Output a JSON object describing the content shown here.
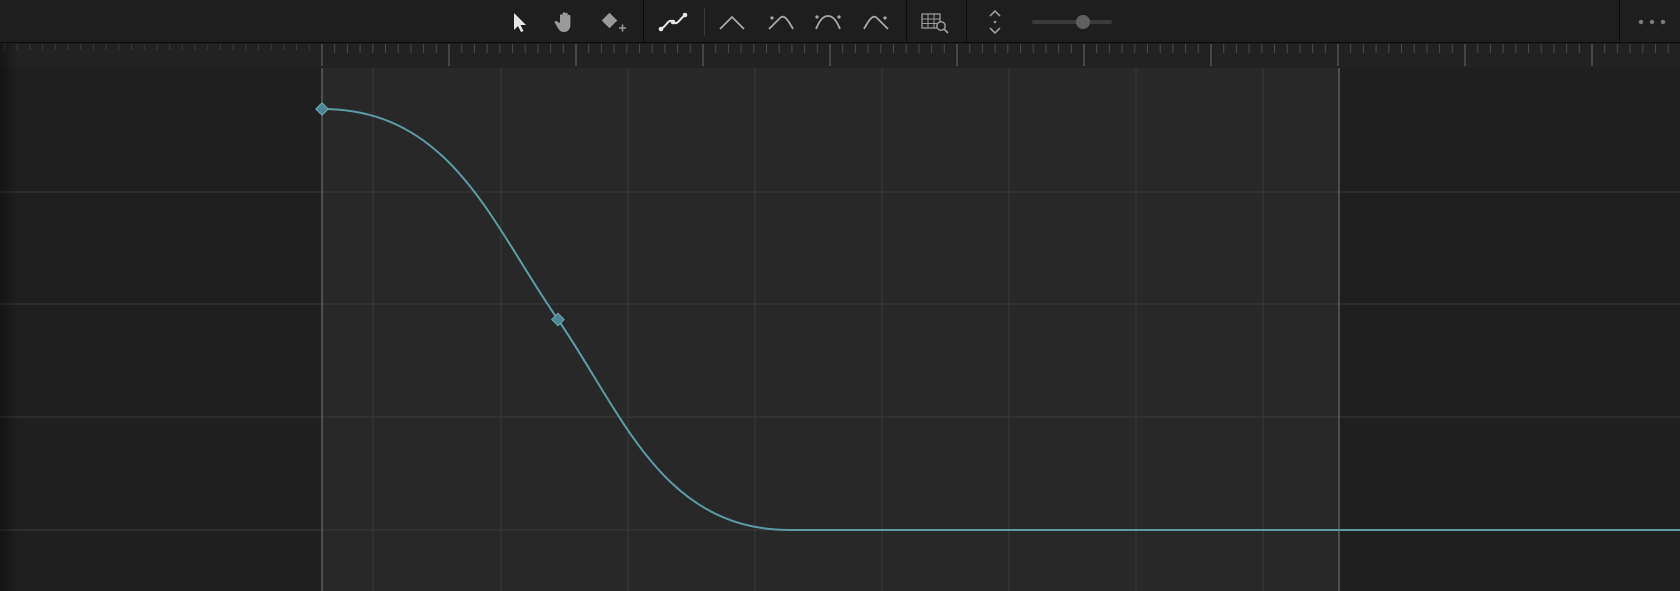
{
  "toolbar": {
    "tools": [
      {
        "name": "select-tool",
        "icon": "arrow-cursor-icon",
        "active": true
      },
      {
        "name": "pan-tool",
        "icon": "hand-icon",
        "active": false
      },
      {
        "name": "add-keyframe-tool",
        "icon": "diamond-plus-icon",
        "active": false
      },
      {
        "name": "smooth-curve-tool",
        "icon": "curve-smooth-icon",
        "active": true
      },
      {
        "name": "linear-interpolation",
        "icon": "interpolation-linear-icon",
        "active": false
      },
      {
        "name": "ease-in-interpolation",
        "icon": "interpolation-ease-in-icon",
        "active": false
      },
      {
        "name": "ease-in-out-interpolation",
        "icon": "interpolation-ease-in-out-icon",
        "active": false
      },
      {
        "name": "ease-out-interpolation",
        "icon": "interpolation-ease-out-icon",
        "active": false
      },
      {
        "name": "frame-all-button",
        "icon": "grid-magnifier-icon",
        "active": false
      },
      {
        "name": "vertical-fit-button",
        "icon": "chevron-up-down-icon",
        "active": false
      }
    ],
    "zoom_level": 0.65,
    "more_icon": "ellipsis-icon"
  },
  "colors": {
    "curve": "#5e9aa6",
    "keyframe": "#4c8894",
    "active_region_bg": "#282828",
    "inactive_region_bg": "#1f1f1f",
    "grid": "#3a3a3a",
    "range_marker": "#6a6a6a"
  },
  "curve_editor": {
    "keyframes": [
      {
        "time": 0.0,
        "value": 1.0
      },
      {
        "time": 0.232,
        "value": 0.5
      },
      {
        "time": 0.46,
        "value": 0.0
      }
    ],
    "end_value": 0.0,
    "active_range": [
      0.0,
      1.0
    ]
  }
}
